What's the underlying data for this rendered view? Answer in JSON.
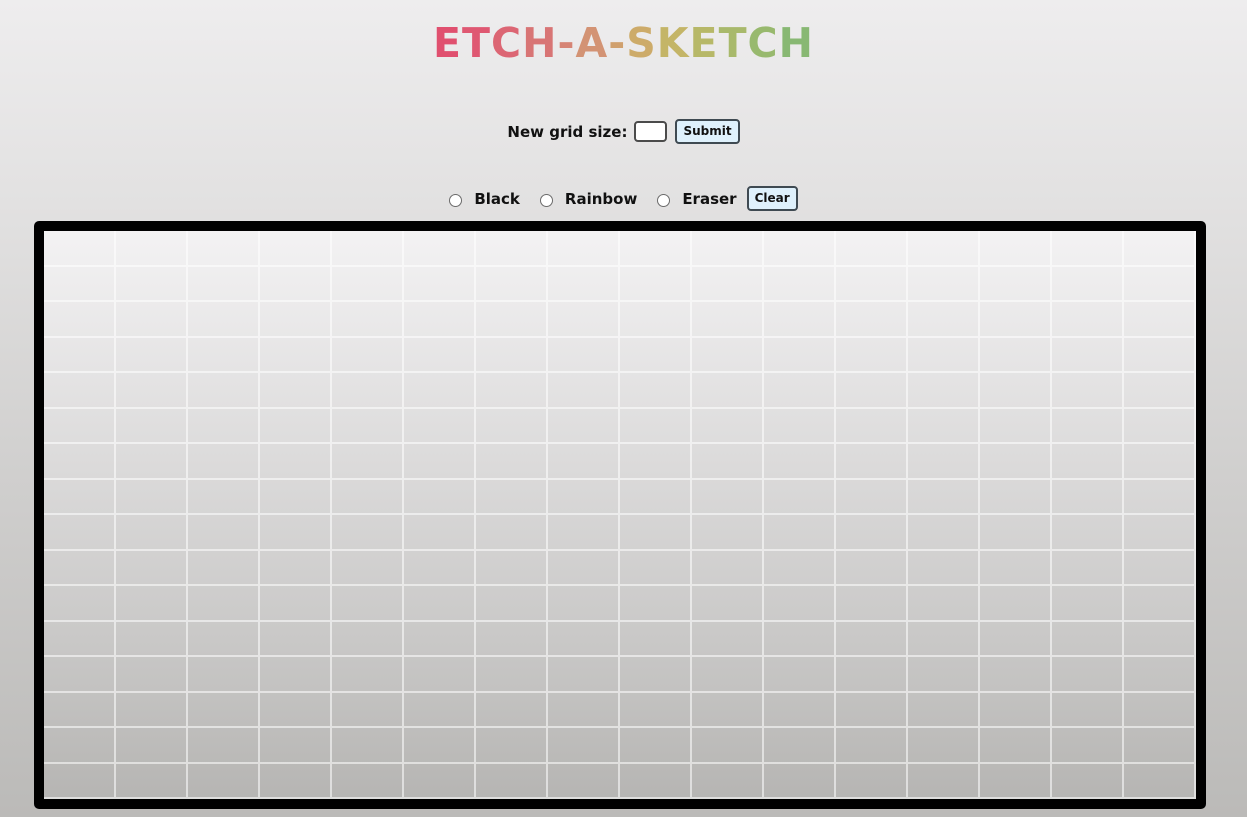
{
  "app": {
    "title_letters": [
      {
        "ch": "E",
        "color": "#e0506f"
      },
      {
        "ch": "T",
        "color": "#df5872"
      },
      {
        "ch": "C",
        "color": "#dc6674"
      },
      {
        "ch": "H",
        "color": "#d87575"
      },
      {
        "ch": "-",
        "color": "#d68475"
      },
      {
        "ch": "A",
        "color": "#d39374"
      },
      {
        "ch": "-",
        "color": "#d0a06e"
      },
      {
        "ch": "S",
        "color": "#cdab69"
      },
      {
        "ch": "K",
        "color": "#c4b567"
      },
      {
        "ch": "E",
        "color": "#b7b868"
      },
      {
        "ch": "T",
        "color": "#a8b96b"
      },
      {
        "ch": "C",
        "color": "#98b96e"
      },
      {
        "ch": "H",
        "color": "#88b873"
      }
    ]
  },
  "grid_controls": {
    "label": "New grid size:",
    "input_value": "",
    "submit_label": "Submit"
  },
  "modes": {
    "options": [
      "Black",
      "Rainbow",
      "Eraser"
    ],
    "clear_label": "Clear"
  },
  "board": {
    "columns": 16,
    "rows": 16,
    "border_color": "#000000"
  }
}
